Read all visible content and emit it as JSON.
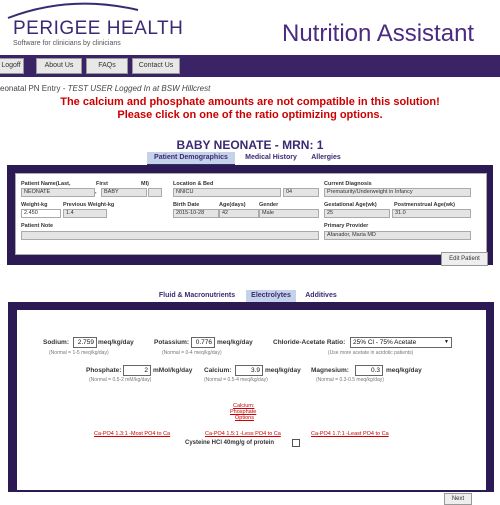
{
  "header": {
    "logo_name": "PERIGEE HEALTH",
    "logo_tagline": "Software for clinicians by clinicians",
    "app_title": "Nutrition Assistant"
  },
  "nav": {
    "logoff": "Logoff",
    "about": "About Us",
    "faqs": "FAQs",
    "contact": "Contact Us"
  },
  "subtitle": {
    "prefix": "eonatal PN Entry - ",
    "user": "TEST USER Logged In at  BSW Hillcrest"
  },
  "errors": {
    "line1": "The calcium and phosphate amounts are not compatible in this solution!",
    "line2": "Please click on one of the ratio optimizing options."
  },
  "patient": {
    "title": "BABY NEONATE - MRN: 1"
  },
  "top_tabs": [
    "Patient Demographics",
    "Medical History",
    "Allergies"
  ],
  "demographics": {
    "labels": {
      "patient_name": "Patient Name(Last,",
      "first": "First",
      "mi": "MI)",
      "location_bed": "Location & Bed",
      "current_diagnosis": "Current Diagnosis",
      "weight": "Weight-kg",
      "previous_weight": "Previous Weight-kg",
      "birth_date": "Birth Date",
      "age_days": "Age(days)",
      "gender": "Gender",
      "gestational_age": "Gestational Age(wk)",
      "postmenstrual_age": "Postmenstrual Age(wk)",
      "patient_note": "Patient Note",
      "primary_provider": "Primary Provider"
    },
    "values": {
      "last_name": "NEONATE",
      "first_name": "BABY",
      "comma": ",",
      "mi": "",
      "location": "NNICU",
      "bed": "04",
      "diagnosis": "Prematurity/Underweight in Infancy",
      "weight": "2.450",
      "previous_weight": "1.4",
      "birth_date": "2015-10-28",
      "age_days": "42",
      "gender": "Male",
      "gestational_age": "25",
      "postmenstrual_age": "31.0",
      "patient_note": "",
      "primary_provider": "Afanador, Maria MD"
    },
    "edit_button": "Edit Patient"
  },
  "mid_tabs": [
    "Fluid & Macronutrients",
    "Electrolytes",
    "Additives"
  ],
  "electrolytes": {
    "sodium": {
      "label": "Sodium:",
      "value": "2.759",
      "unit": "meq/kg/day",
      "note": "(Normal = 1-5 meq/kg/day)"
    },
    "potassium": {
      "label": "Potassium:",
      "value": "0.776",
      "unit": "meq/kg/day",
      "note": "(Normal = 0-4 meq/kg/day)"
    },
    "chloride": {
      "label": "Chloride-Acetate Ratio:",
      "value": "25% Cl - 75% Acetate",
      "note": "(Use more acetate in acidotic patients)"
    },
    "phosphate": {
      "label": "Phosphate:",
      "value": "2",
      "unit": "mMol/kg/day",
      "note": "(Normal = 0.5-2 mM/kg/day)"
    },
    "calcium": {
      "label": "Calcium:",
      "value": "3.9",
      "unit": "meq/kg/day",
      "note": "(Normal = 0.5-4 meq/kg/day)"
    },
    "magnesium": {
      "label": "Magnesium:",
      "value": "0.3",
      "unit": "meq/kg/day",
      "note": "(Normal = 0.3-0.5 meq/kg/day)"
    },
    "options_title": [
      "Calcium:",
      "Phosphate",
      "Options"
    ],
    "options": [
      "Ca-PO4 1.3:1 -Most PO4 to Ca",
      "Ca-PO4 1.5:1 -Less PO4 to Ca",
      "Ca-PO4 1.7:1 -Least PO4 to Ca"
    ],
    "cysteine_label": "Cysteine HCl 40mg/g of protein"
  },
  "next_button": "Next",
  "colors": {
    "brand": "#3b2a73",
    "error": "#cc0000",
    "panel": "#2c1a55"
  }
}
